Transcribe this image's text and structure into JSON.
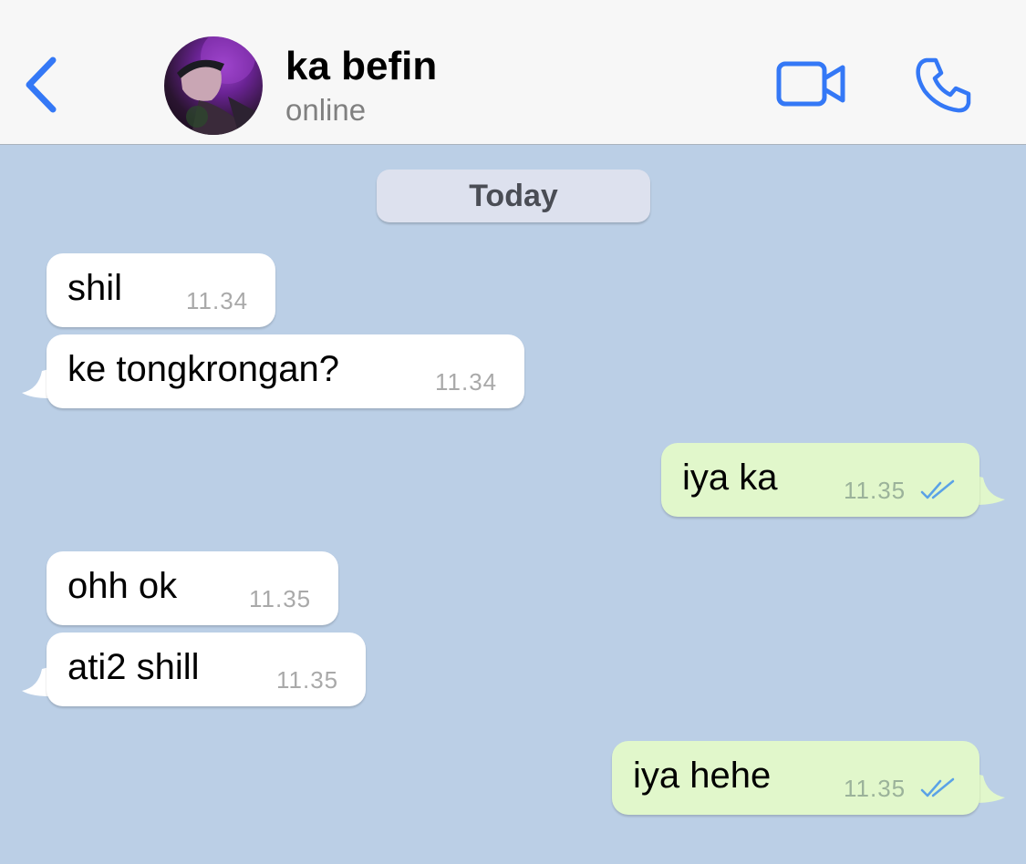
{
  "header": {
    "back_icon": "chevron-left-icon",
    "contact_name": "ka befin",
    "status": "online",
    "video_icon": "video-camera-icon",
    "call_icon": "phone-icon",
    "accent_color": "#3478f6"
  },
  "date_separator": "Today",
  "messages": [
    {
      "direction": "incoming",
      "text": "shil",
      "time": "11.34"
    },
    {
      "direction": "incoming",
      "text": "ke tongkrongan?",
      "time": "11.34"
    },
    {
      "direction": "outgoing",
      "text": "iya ka",
      "time": "11.35",
      "status_icon": "double-check-icon"
    },
    {
      "direction": "incoming",
      "text": "ohh ok",
      "time": "11.35"
    },
    {
      "direction": "incoming",
      "text": "ati2 shill",
      "time": "11.35"
    },
    {
      "direction": "outgoing",
      "text": "iya hehe",
      "time": "11.35",
      "status_icon": "double-check-icon"
    }
  ],
  "colors": {
    "chat_background": "#bbcfe6",
    "incoming_bubble": "#ffffff",
    "outgoing_bubble": "#e1f7cb",
    "read_ticks": "#5aa2e6"
  }
}
